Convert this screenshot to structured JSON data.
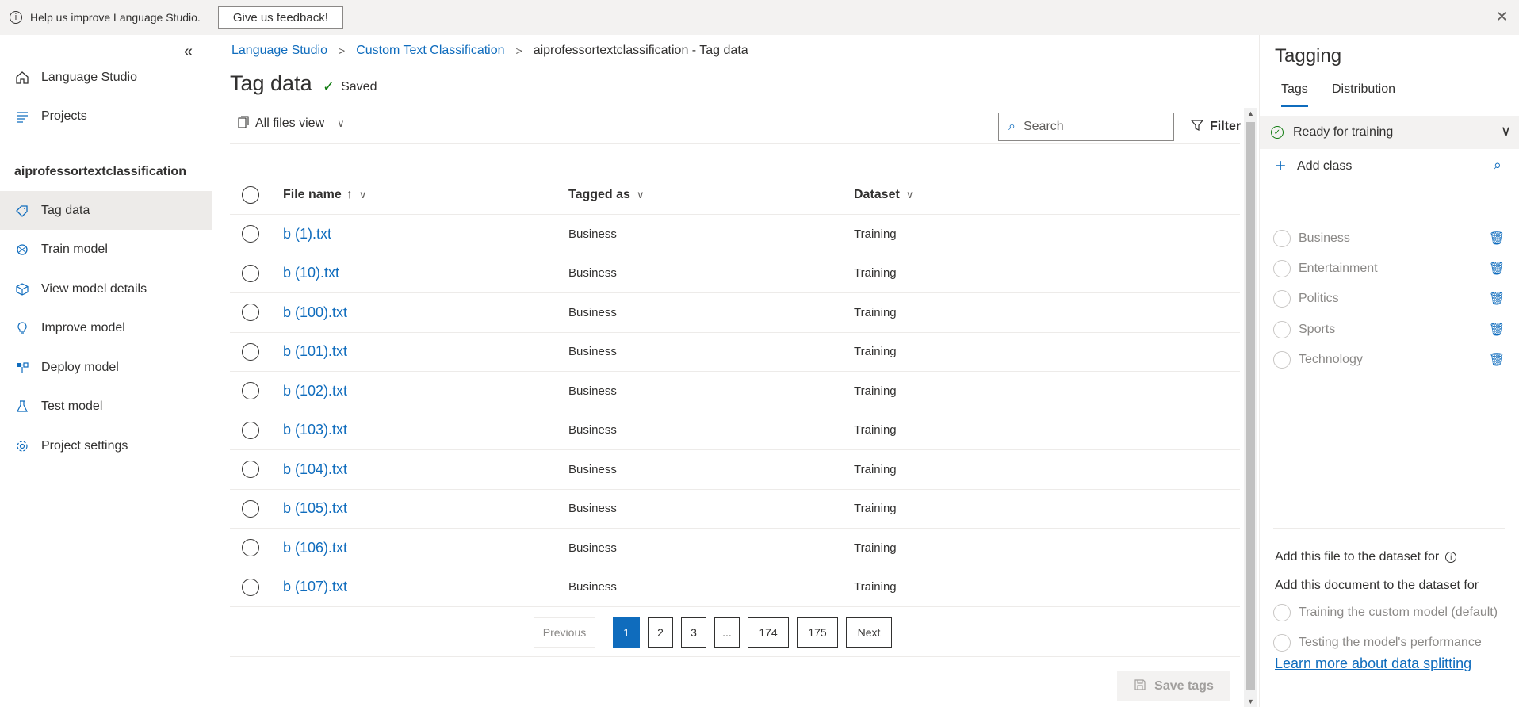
{
  "banner": {
    "text": "Help us improve Language Studio.",
    "feedback_label": "Give us feedback!"
  },
  "sidebar": {
    "collapse_icon": "«",
    "items_top": [
      {
        "label": "Language Studio",
        "icon": "home-icon"
      },
      {
        "label": "Projects",
        "icon": "list-icon"
      }
    ],
    "project_name": "aiprofessortextclassification",
    "items_project": [
      {
        "label": "Tag data",
        "icon": "tag-icon",
        "active": true
      },
      {
        "label": "Train model",
        "icon": "brain-icon"
      },
      {
        "label": "View model details",
        "icon": "cube-icon"
      },
      {
        "label": "Improve model",
        "icon": "lightbulb-icon"
      },
      {
        "label": "Deploy model",
        "icon": "deploy-icon"
      },
      {
        "label": "Test model",
        "icon": "flask-icon"
      },
      {
        "label": "Project settings",
        "icon": "gear-icon"
      }
    ]
  },
  "breadcrumb": {
    "items": [
      "Language Studio",
      "Custom Text Classification",
      "aiprofessortextclassification - Tag data"
    ]
  },
  "page": {
    "title": "Tag data",
    "saved_label": "Saved"
  },
  "toolbar": {
    "view_label": "All files view",
    "search_placeholder": "Search",
    "filter_label": "Filter"
  },
  "table": {
    "columns": [
      "File name",
      "Tagged as",
      "Dataset"
    ],
    "rows": [
      {
        "file": "b (1).txt",
        "tag": "Business",
        "dataset": "Training"
      },
      {
        "file": "b (10).txt",
        "tag": "Business",
        "dataset": "Training"
      },
      {
        "file": "b (100).txt",
        "tag": "Business",
        "dataset": "Training"
      },
      {
        "file": "b (101).txt",
        "tag": "Business",
        "dataset": "Training"
      },
      {
        "file": "b (102).txt",
        "tag": "Business",
        "dataset": "Training"
      },
      {
        "file": "b (103).txt",
        "tag": "Business",
        "dataset": "Training"
      },
      {
        "file": "b (104).txt",
        "tag": "Business",
        "dataset": "Training"
      },
      {
        "file": "b (105).txt",
        "tag": "Business",
        "dataset": "Training"
      },
      {
        "file": "b (106).txt",
        "tag": "Business",
        "dataset": "Training"
      },
      {
        "file": "b (107).txt",
        "tag": "Business",
        "dataset": "Training"
      }
    ]
  },
  "pagination": {
    "previous": "Previous",
    "pages": [
      "1",
      "2",
      "3",
      "...",
      "174",
      "175"
    ],
    "current": "1",
    "next": "Next"
  },
  "save_tags_label": "Save tags",
  "panel": {
    "title": "Tagging",
    "tabs": [
      "Tags",
      "Distribution"
    ],
    "status": "Ready for training",
    "add_class_label": "Add class",
    "classes": [
      "Business",
      "Entertainment",
      "Politics",
      "Sports",
      "Technology"
    ],
    "dataset_title": "Add this file to the dataset for",
    "dataset_subtitle": "Add this document to the dataset for",
    "dataset_options": [
      "Training the custom model (default)",
      "Testing the model's performance"
    ],
    "learn_more": "Learn more about data splitting"
  },
  "colors": {
    "accent": "#0f6cbd",
    "success": "#107c10",
    "banner_bg": "#f3f2f1"
  }
}
